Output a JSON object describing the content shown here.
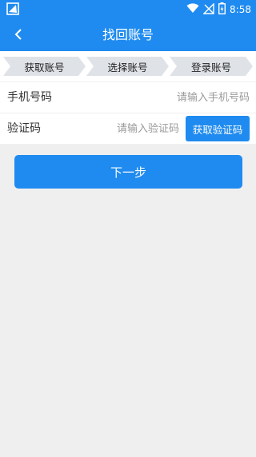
{
  "status_bar": {
    "time": "8:58"
  },
  "nav": {
    "title": "找回账号"
  },
  "steps": [
    "获取账号",
    "选择账号",
    "登录账号"
  ],
  "form": {
    "phone_label": "手机号码",
    "phone_placeholder": "请输入手机号码",
    "code_label": "验证码",
    "code_placeholder": "请输入验证码",
    "get_code_label": "获取验证码"
  },
  "next_label": "下一步",
  "colors": {
    "accent": "#1f8bf0",
    "background": "#efefef",
    "step_fill": "#dfe3e8"
  }
}
